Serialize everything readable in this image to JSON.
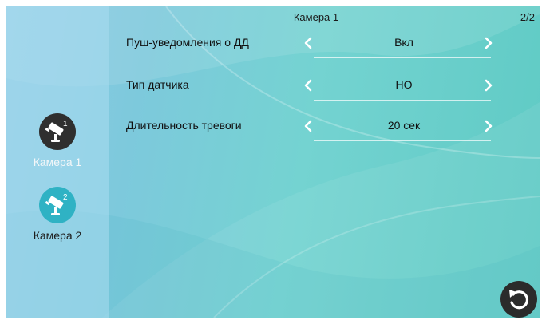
{
  "header": {
    "title": "Камера 1",
    "page_indicator": "2/2"
  },
  "sidebar": {
    "items": [
      {
        "label": "Камера 1",
        "badge": "1",
        "icon": "cctv-camera-icon",
        "active": true,
        "circle_color": "#2f2f2f"
      },
      {
        "label": "Камера 2",
        "badge": "2",
        "icon": "cctv-camera-icon",
        "active": false,
        "circle_color": "#2fb2c4"
      }
    ]
  },
  "settings": [
    {
      "label": "Пуш-уведомления о ДД",
      "value": "Вкл"
    },
    {
      "label": "Тип датчика",
      "value": "НО"
    },
    {
      "label": "Длительность тревоги",
      "value": "20 сек"
    }
  ],
  "footer": {
    "back_icon": "undo-arrow-icon"
  }
}
